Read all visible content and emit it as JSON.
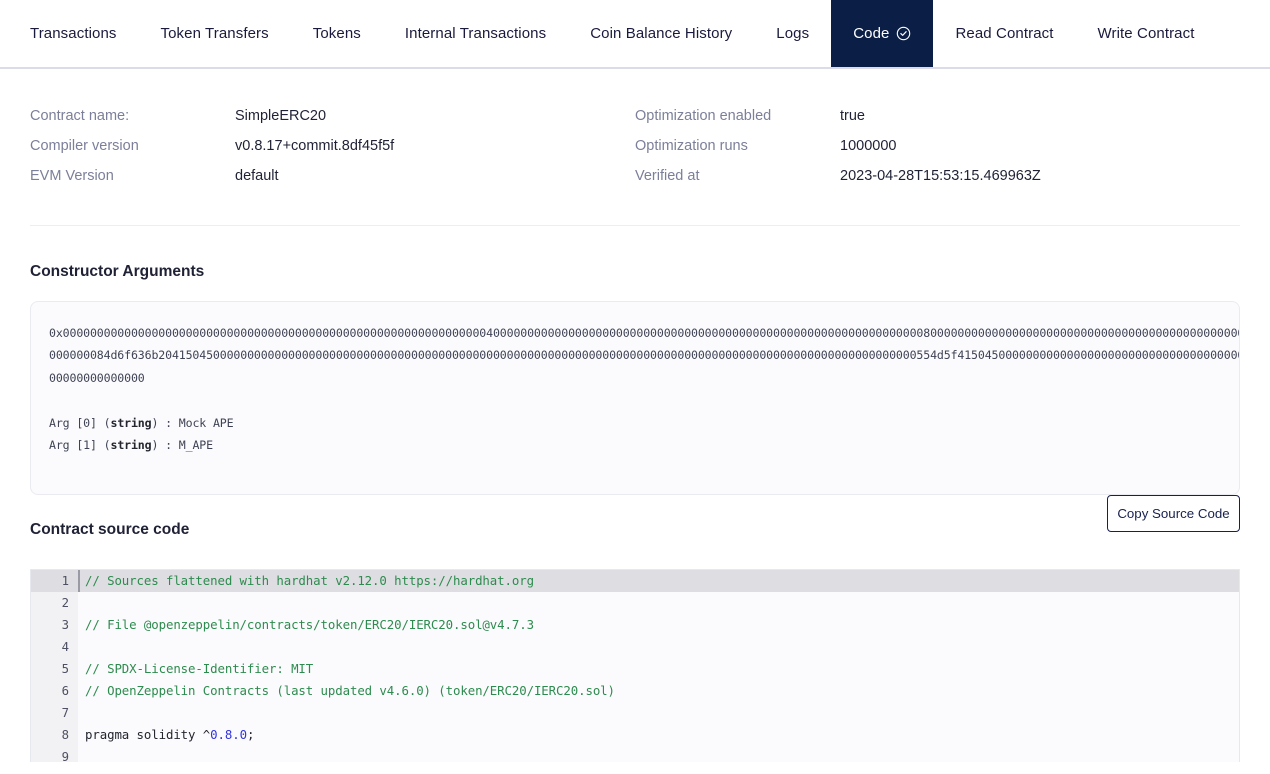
{
  "tabs": [
    {
      "label": "Transactions",
      "active": false,
      "icon": null
    },
    {
      "label": "Token Transfers",
      "active": false,
      "icon": null
    },
    {
      "label": "Tokens",
      "active": false,
      "icon": null
    },
    {
      "label": "Internal Transactions",
      "active": false,
      "icon": null
    },
    {
      "label": "Coin Balance History",
      "active": false,
      "icon": null
    },
    {
      "label": "Logs",
      "active": false,
      "icon": null
    },
    {
      "label": "Code",
      "active": true,
      "icon": "check-circle-icon"
    },
    {
      "label": "Read Contract",
      "active": false,
      "icon": null
    },
    {
      "label": "Write Contract",
      "active": false,
      "icon": null
    }
  ],
  "contract_info": {
    "left": [
      {
        "label": "Contract name:",
        "value": "SimpleERC20"
      },
      {
        "label": "Compiler version",
        "value": "v0.8.17+commit.8df45f5f"
      },
      {
        "label": "EVM Version",
        "value": "default"
      }
    ],
    "right": [
      {
        "label": "Optimization enabled",
        "value": "true"
      },
      {
        "label": "Optimization runs",
        "value": "1000000"
      },
      {
        "label": "Verified at",
        "value": "2023-04-28T15:53:15.469963Z"
      }
    ]
  },
  "constructor_arguments": {
    "heading": "Constructor Arguments",
    "hex_line_1": "0x0000000000000000000000000000000000000000000000000000000000000040000000000000000000000000000000000000000000000000000000000000008000000000000000000000000000000000000000000000000000000000000000",
    "hex_line_2": "000000084d6f636b204150450000000000000000000000000000000000000000000000000000000000000000000000000000000000000000000000000000000554d5f41504500000000000000000000000000000000000000000000000000",
    "hex_line_3": "00000000000000",
    "args": [
      {
        "index": "Arg [0]",
        "type": "string",
        "value": "Mock APE"
      },
      {
        "index": "Arg [1]",
        "type": "string",
        "value": "M_APE"
      }
    ]
  },
  "source_code": {
    "heading": "Contract source code",
    "copy_button_label": "Copy Source Code",
    "lines": [
      {
        "n": "1",
        "active": true,
        "tokens": [
          {
            "t": "comment",
            "s": "// Sources flattened with hardhat v2.12.0 https://hardhat.org"
          }
        ]
      },
      {
        "n": "2",
        "active": false,
        "tokens": []
      },
      {
        "n": "3",
        "active": false,
        "tokens": [
          {
            "t": "comment",
            "s": "// File @openzeppelin/contracts/token/ERC20/IERC20.sol@v4.7.3"
          }
        ]
      },
      {
        "n": "4",
        "active": false,
        "tokens": []
      },
      {
        "n": "5",
        "active": false,
        "tokens": [
          {
            "t": "comment",
            "s": "// SPDX-License-Identifier: MIT"
          }
        ]
      },
      {
        "n": "6",
        "active": false,
        "tokens": [
          {
            "t": "comment",
            "s": "// OpenZeppelin Contracts (last updated v4.6.0) (token/ERC20/IERC20.sol)"
          }
        ]
      },
      {
        "n": "7",
        "active": false,
        "tokens": []
      },
      {
        "n": "8",
        "active": false,
        "tokens": [
          {
            "t": "plain",
            "s": "pragma solidity ^"
          },
          {
            "t": "num",
            "s": "0.8.0"
          },
          {
            "t": "plain",
            "s": ";"
          }
        ]
      },
      {
        "n": "9",
        "active": false,
        "tokens": []
      }
    ]
  },
  "colors": {
    "active_tab_bg": "#0b1f46",
    "accent_navy": "#18214d",
    "label_gray": "#7b7f99",
    "comment_green": "#2e8b4f",
    "number_blue": "#3333dd",
    "page_bg": "#ffffff",
    "panel_bg": "#fbfbfd"
  }
}
